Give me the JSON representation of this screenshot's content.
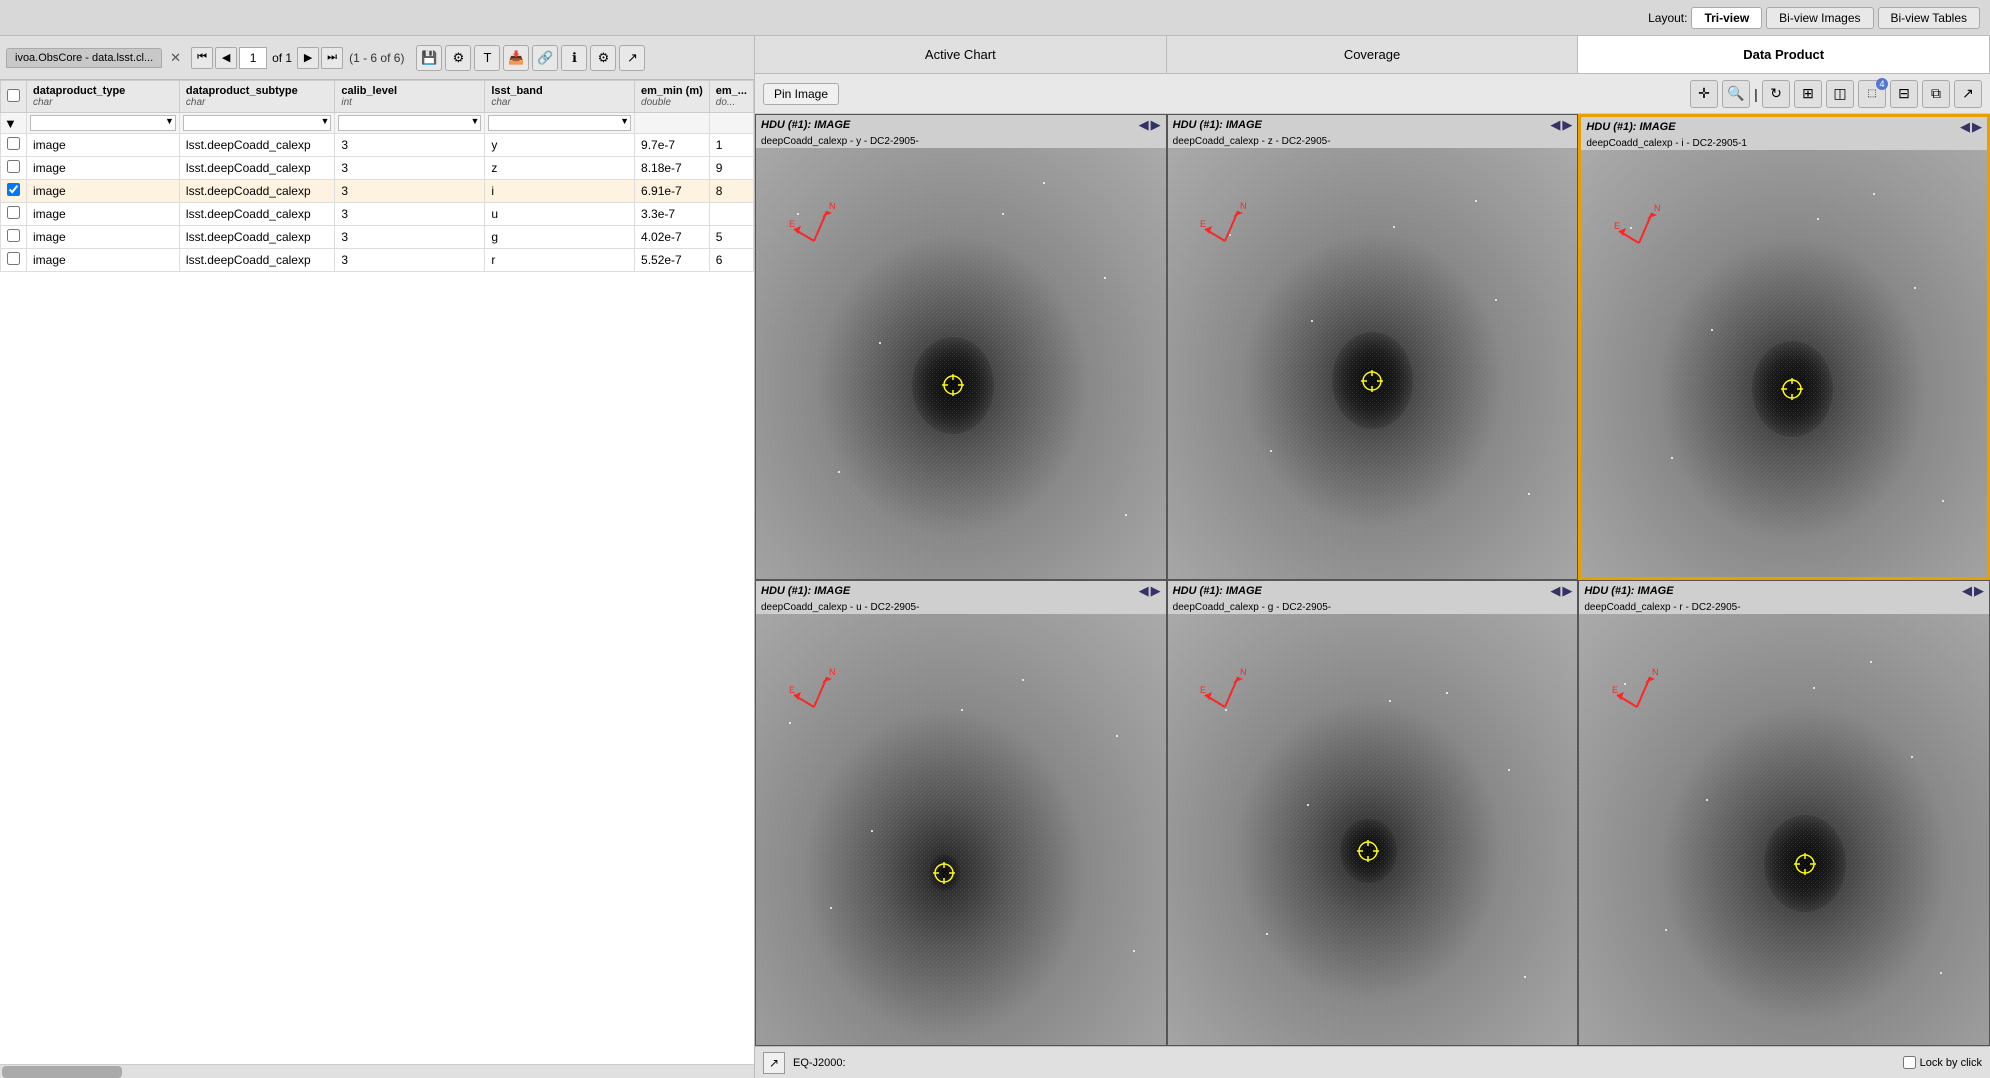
{
  "layout": {
    "label": "Layout:",
    "buttons": [
      "Tri-view",
      "Bi-view Images",
      "Bi-view Tables"
    ],
    "active": "Tri-view"
  },
  "left_panel": {
    "tab_label": "ivoa.ObsCore - data.lsst.cl...",
    "page_current": "1",
    "page_total": "of 1",
    "row_range": "(1 - 6 of 6)",
    "columns": [
      {
        "name": "dataproduct_type",
        "type": "char"
      },
      {
        "name": "dataproduct_subtype",
        "type": "char"
      },
      {
        "name": "calib_level",
        "type": "int"
      },
      {
        "name": "lsst_band",
        "type": "char"
      },
      {
        "name": "em_min (m)",
        "type": "double"
      },
      {
        "name": "em_...",
        "type": "do..."
      }
    ],
    "rows": [
      {
        "type": "image",
        "subtype": "lsst.deepCoadd_calexp",
        "calib": "3",
        "band": "y",
        "em_min": "9.7e-7",
        "em_other": "1",
        "selected": false
      },
      {
        "type": "image",
        "subtype": "lsst.deepCoadd_calexp",
        "calib": "3",
        "band": "z",
        "em_min": "8.18e-7",
        "em_other": "9",
        "selected": false
      },
      {
        "type": "image",
        "subtype": "lsst.deepCoadd_calexp",
        "calib": "3",
        "band": "i",
        "em_min": "6.91e-7",
        "em_other": "8",
        "selected": true
      },
      {
        "type": "image",
        "subtype": "lsst.deepCoadd_calexp",
        "calib": "3",
        "band": "u",
        "em_min": "3.3e-7",
        "em_other": "",
        "selected": false
      },
      {
        "type": "image",
        "subtype": "lsst.deepCoadd_calexp",
        "calib": "3",
        "band": "g",
        "em_min": "4.02e-7",
        "em_other": "5",
        "selected": false
      },
      {
        "type": "image",
        "subtype": "lsst.deepCoadd_calexp",
        "calib": "3",
        "band": "r",
        "em_min": "5.52e-7",
        "em_other": "6",
        "selected": false
      }
    ]
  },
  "right_panel": {
    "tabs": [
      "Active Chart",
      "Coverage",
      "Data Product"
    ],
    "active_tab": "Data Product",
    "toolbar": {
      "pin_button": "Pin Image"
    },
    "images": [
      {
        "id": "y",
        "hdu": "HDU (#1): IMAGE",
        "sub": "deepCoadd_calexp - y - DC2-2905-",
        "selected": false,
        "has_galaxy": true,
        "galaxy_size": "large",
        "band_brightness": 0.6
      },
      {
        "id": "z",
        "hdu": "HDU (#1): IMAGE",
        "sub": "deepCoadd_calexp - z - DC2-2905-",
        "selected": false,
        "has_galaxy": true,
        "galaxy_size": "large",
        "band_brightness": 0.5
      },
      {
        "id": "i",
        "hdu": "HDU (#1): IMAGE",
        "sub": "deepCoadd_calexp - i - DC2-2905-1",
        "selected": true,
        "has_galaxy": true,
        "galaxy_size": "large",
        "band_brightness": 0.4
      },
      {
        "id": "u",
        "hdu": "HDU (#1): IMAGE",
        "sub": "deepCoadd_calexp - u - DC2-2905-",
        "selected": false,
        "has_galaxy": true,
        "galaxy_size": "small",
        "band_brightness": 0.8
      },
      {
        "id": "g",
        "hdu": "HDU (#1): IMAGE",
        "sub": "deepCoadd_calexp - g - DC2-2905-",
        "selected": false,
        "has_galaxy": true,
        "galaxy_size": "medium",
        "band_brightness": 0.6
      },
      {
        "id": "r",
        "hdu": "HDU (#1): IMAGE",
        "sub": "deepCoadd_calexp - r - DC2-2905-",
        "selected": false,
        "has_galaxy": true,
        "galaxy_size": "large",
        "band_brightness": 0.5
      }
    ],
    "status_bar": {
      "eq_label": "EQ-J2000:",
      "lock_label": "Lock by click"
    }
  }
}
